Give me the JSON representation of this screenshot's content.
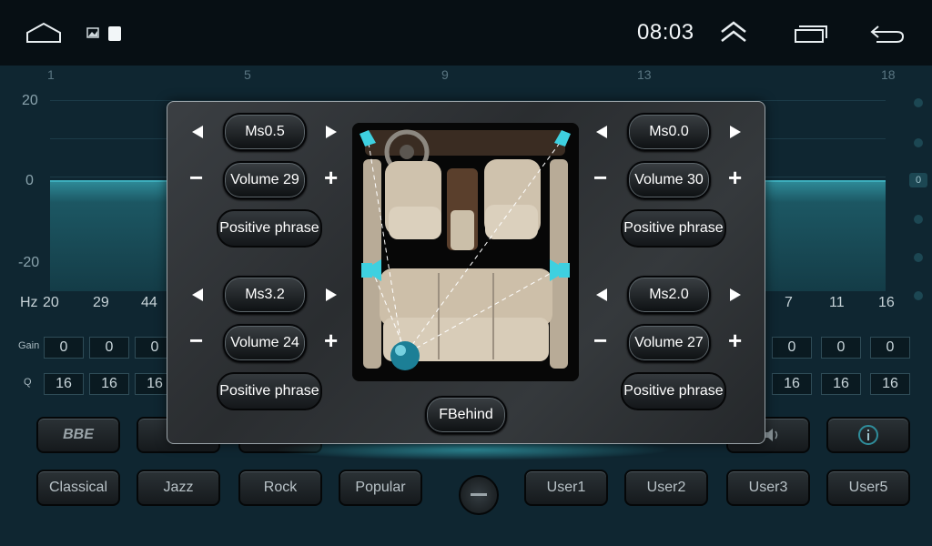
{
  "statusbar": {
    "time": "08:03",
    "icons": [
      "home-icon",
      "image-icon",
      "square-icon",
      "expand-up-icon",
      "recents-icon",
      "back-icon"
    ]
  },
  "eq": {
    "freq_numbers": [
      "1",
      "5",
      "9",
      "13",
      "18"
    ],
    "db_labels": [
      "20",
      "0",
      "-20"
    ],
    "hz_label": "Hz",
    "hz_values_left": [
      "20",
      "29",
      "44"
    ],
    "hz_values_right": [
      "7",
      "11",
      "16"
    ],
    "gain_label": "Gain",
    "q_label": "Q",
    "gain_values_left": [
      "0",
      "0",
      "0"
    ],
    "gain_values_right": [
      "0",
      "0",
      "0"
    ],
    "q_values_left": [
      "16",
      "16",
      "16"
    ],
    "q_values_right": [
      "16",
      "16",
      "16"
    ],
    "side_value": "0",
    "logo_text": "BBE",
    "presets": [
      "Classical",
      "Jazz",
      "Rock",
      "Popular",
      "User1",
      "User2",
      "User3",
      "User5"
    ],
    "accent_color": "#47c4d4"
  },
  "dialog": {
    "front_left": {
      "delay": "Ms0.5",
      "volume": "Volume 29",
      "phase": "Positive phrase"
    },
    "front_right": {
      "delay": "Ms0.0",
      "volume": "Volume 30",
      "phase": "Positive phrase"
    },
    "rear_left": {
      "delay": "Ms3.2",
      "volume": "Volume 24",
      "phase": "Positive phrase"
    },
    "rear_right": {
      "delay": "Ms2.0",
      "volume": "Volume 27",
      "phase": "Positive phrase"
    },
    "position_button": "FBehind",
    "minus": "−",
    "plus": "+"
  }
}
